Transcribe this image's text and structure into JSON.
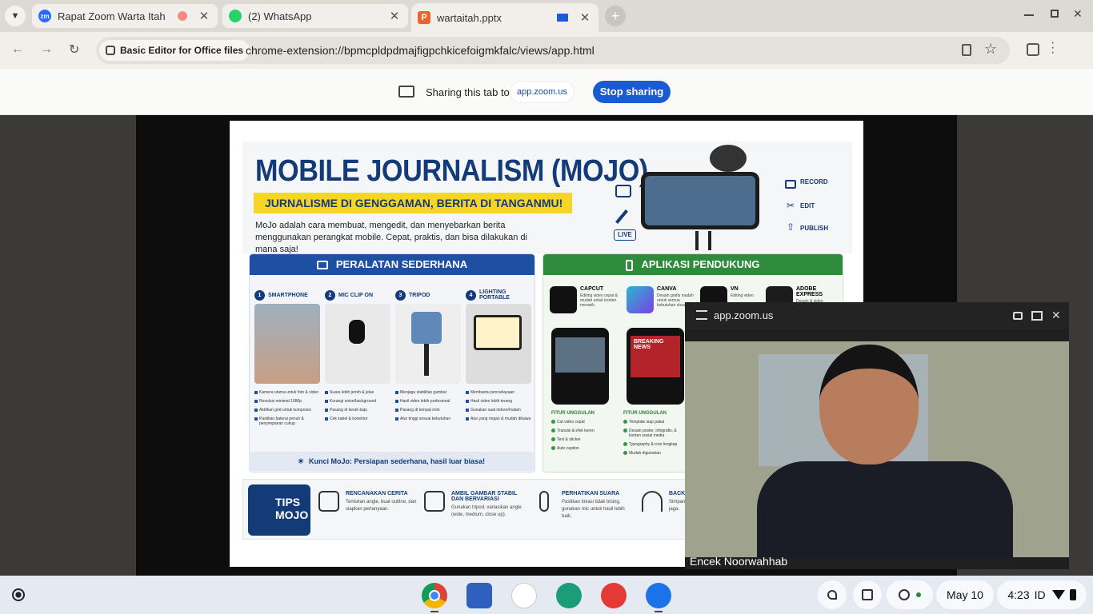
{
  "browser": {
    "tabs": [
      {
        "title": "Rapat Zoom Warta Itah",
        "favicon_text": "zm",
        "favicon_color": "#2d68ff"
      },
      {
        "title": "(2) WhatsApp",
        "favicon_color": "#25d366"
      },
      {
        "title": "wartaitah.pptx",
        "favicon_color": "#e8662d"
      }
    ],
    "new_tab_icon": "plus-icon",
    "site_chip": "Basic Editor for Office files",
    "url": "chrome-extension://bpmcpldpdmajfigpchkicefoigmkfalc/views/app.html"
  },
  "sharing": {
    "text": "Sharing this tab to",
    "target": "app.zoom.us",
    "stop_label": "Stop sharing"
  },
  "slide": {
    "title": "MOBILE JOURNALISM (MOJO)",
    "subtitle": "JURNALISME DI GENGGAMAN, BERITA DI TANGANMU!",
    "description": "MoJo adalah cara membuat, mengedit, dan menyebarkan berita menggunakan perangkat mobile. Cepat, praktis, dan bisa dilakukan di mana saja!",
    "actions": [
      "RECORD",
      "EDIT",
      "PUBLISH"
    ],
    "live_label": "LIVE",
    "tools_header": "PERALATAN SEDERHANA",
    "tools": [
      {
        "num": "1",
        "label": "SMARTPHONE",
        "points": [
          "Kamera utama untuk foto & video",
          "Resolusi minimal 1080p",
          "Aktifkan grid untuk komposisi",
          "Pastikan baterai penuh & penyimpanan cukup"
        ]
      },
      {
        "num": "2",
        "label": "MIC CLIP ON",
        "points": [
          "Suara lebih jernih & jelas",
          "Kurangi noise/background",
          "Pasang di kerah baju",
          "Cek kabel & konektor"
        ]
      },
      {
        "num": "3",
        "label": "TRIPOD",
        "points": [
          "Menjaga stabilitas gambar",
          "Hasil video lebih profesional",
          "Pasang di tempat mini",
          "Atur tinggi sesuai kebutuhan"
        ]
      },
      {
        "num": "4",
        "label": "LIGHTING PORTABLE",
        "points": [
          "Membantu pencahayaan",
          "Hasil video lebih terang",
          "Gunakan saat indoor/malam",
          "Atur yang ringan & mudah dibawa"
        ]
      }
    ],
    "kunci": "Kunci MoJo: Persiapan sederhana, hasil luar biasa!",
    "apps_header": "APLIKASI PENDUKUNG",
    "apps": [
      {
        "name": "CAPCUT",
        "desc": "Editing video cepat & mudah untuk konten menarik.",
        "color": "#111111"
      },
      {
        "name": "CANVA",
        "desc": "Desain grafis mudah untuk semua kebutuhan visual",
        "color": "#2ab7ce"
      },
      {
        "name": "VN",
        "desc": "Editing video",
        "color": "#111111"
      },
      {
        "name": "ADOBE EXPRESS",
        "desc": "Desain & video",
        "color": "#1b1b1b"
      }
    ],
    "breaking": "BREAKING NEWS",
    "features": [
      {
        "header": "FITUR UNGGULAN",
        "items": [
          "Cut video cepat",
          "Transisi & efek keren",
          "Text & sticker",
          "Auto caption"
        ]
      },
      {
        "header": "FITUR UNGGULAN",
        "items": [
          "Template siap pakai",
          "Desain poster, infografis, & konten sosial media",
          "Typography & icon lengkap",
          "Mudah digunakan"
        ]
      }
    ],
    "tips_badge": "TIPS MOJO",
    "tips": [
      {
        "title": "RENCANAKAN CERITA",
        "desc": "Tentukan angle, buat outline, dan siapkan pertanyaan."
      },
      {
        "title": "AMBIL GAMBAR STABIL DAN BERVARIASI",
        "desc": "Gunakan tripod, variasikan angle (wide, medium, close up)."
      },
      {
        "title": "PERHATIKAN SUARA",
        "desc": "Pastikan lokasi tidak bising, gunakan mic untuk hasil lebih baik."
      },
      {
        "title": "BACKU",
        "desc": "Simpan hardisk jaga."
      }
    ]
  },
  "zoom": {
    "title": "app.zoom.us",
    "participant": "Encek Noorwahhab"
  },
  "shelf": {
    "apps": [
      {
        "name": "chrome-icon",
        "color": "#db4437"
      },
      {
        "name": "reader-icon",
        "color": "#2f5fbf"
      },
      {
        "name": "ruang-gtk-icon",
        "color": "#ffffff"
      },
      {
        "name": "classroom-icon",
        "color": "#1b9e77"
      },
      {
        "name": "paint-icon",
        "color": "#e53935"
      },
      {
        "name": "files-icon",
        "color": "#1a73e8"
      }
    ],
    "date": "May 10",
    "time": "4:23",
    "locale": "ID"
  }
}
